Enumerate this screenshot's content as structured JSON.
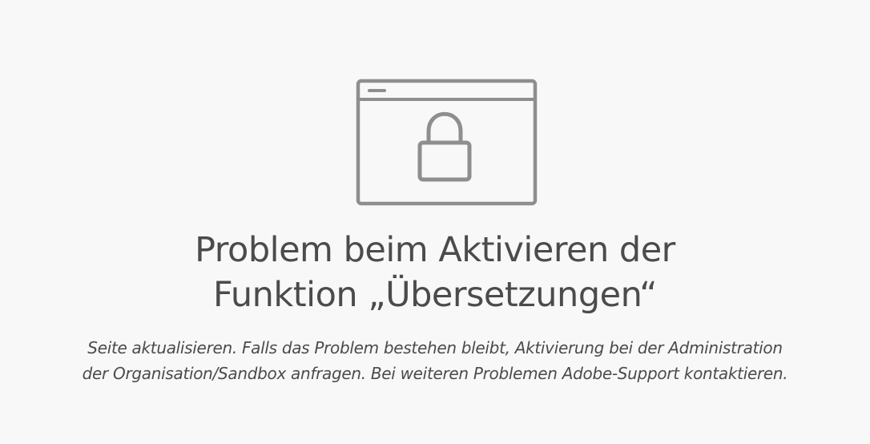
{
  "illustration": {
    "icon": "locked-browser-window-icon",
    "stroke_color": "#8e8e8e"
  },
  "error": {
    "title_line1": "Problem beim Aktivieren der",
    "title_line2": "Funktion „Übersetzungen“",
    "description_line1": "Seite aktualisieren. Falls das Problem bestehen bleibt, Aktivierung bei der Administration",
    "description_line2": "der Organisation/Sandbox anfragen. Bei weiteren Problemen Adobe-Support kontaktieren."
  },
  "colors": {
    "background": "#f8f8f8",
    "text": "#4b4b4b"
  }
}
